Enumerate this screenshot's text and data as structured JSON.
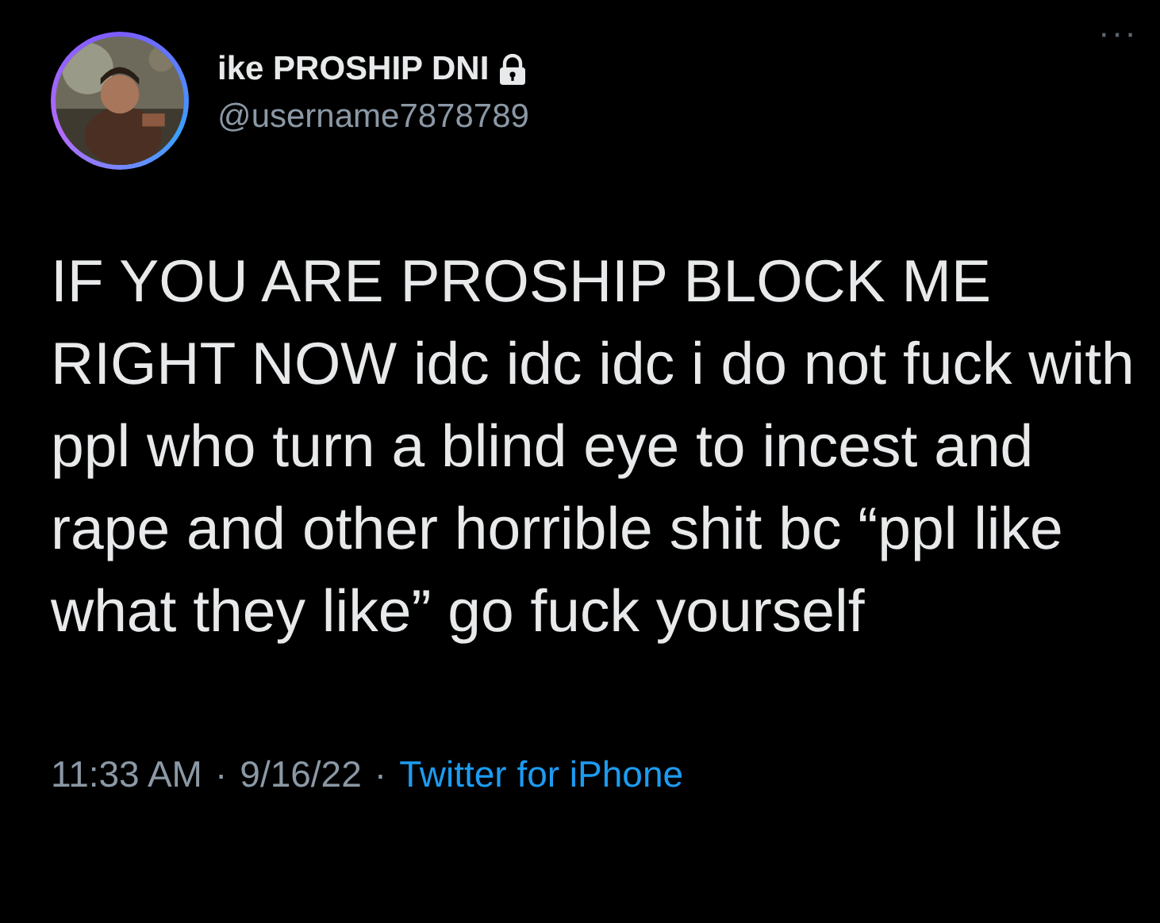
{
  "author": {
    "name": "ike PROSHIP DNI",
    "locked": true,
    "handle": "@username7878789"
  },
  "more_button": "···",
  "text": "IF YOU ARE PROSHIP BLOCK ME RIGHT NOW idc idc idc i do not fuck with ppl who turn a blind eye to incest and rape and other horrible shit bc “ppl like what they like” go fuck yourself",
  "meta": {
    "time": "11:33 AM",
    "separator_1": "·",
    "date": "9/16/22",
    "separator_2": "·",
    "source": "Twitter for iPhone"
  }
}
